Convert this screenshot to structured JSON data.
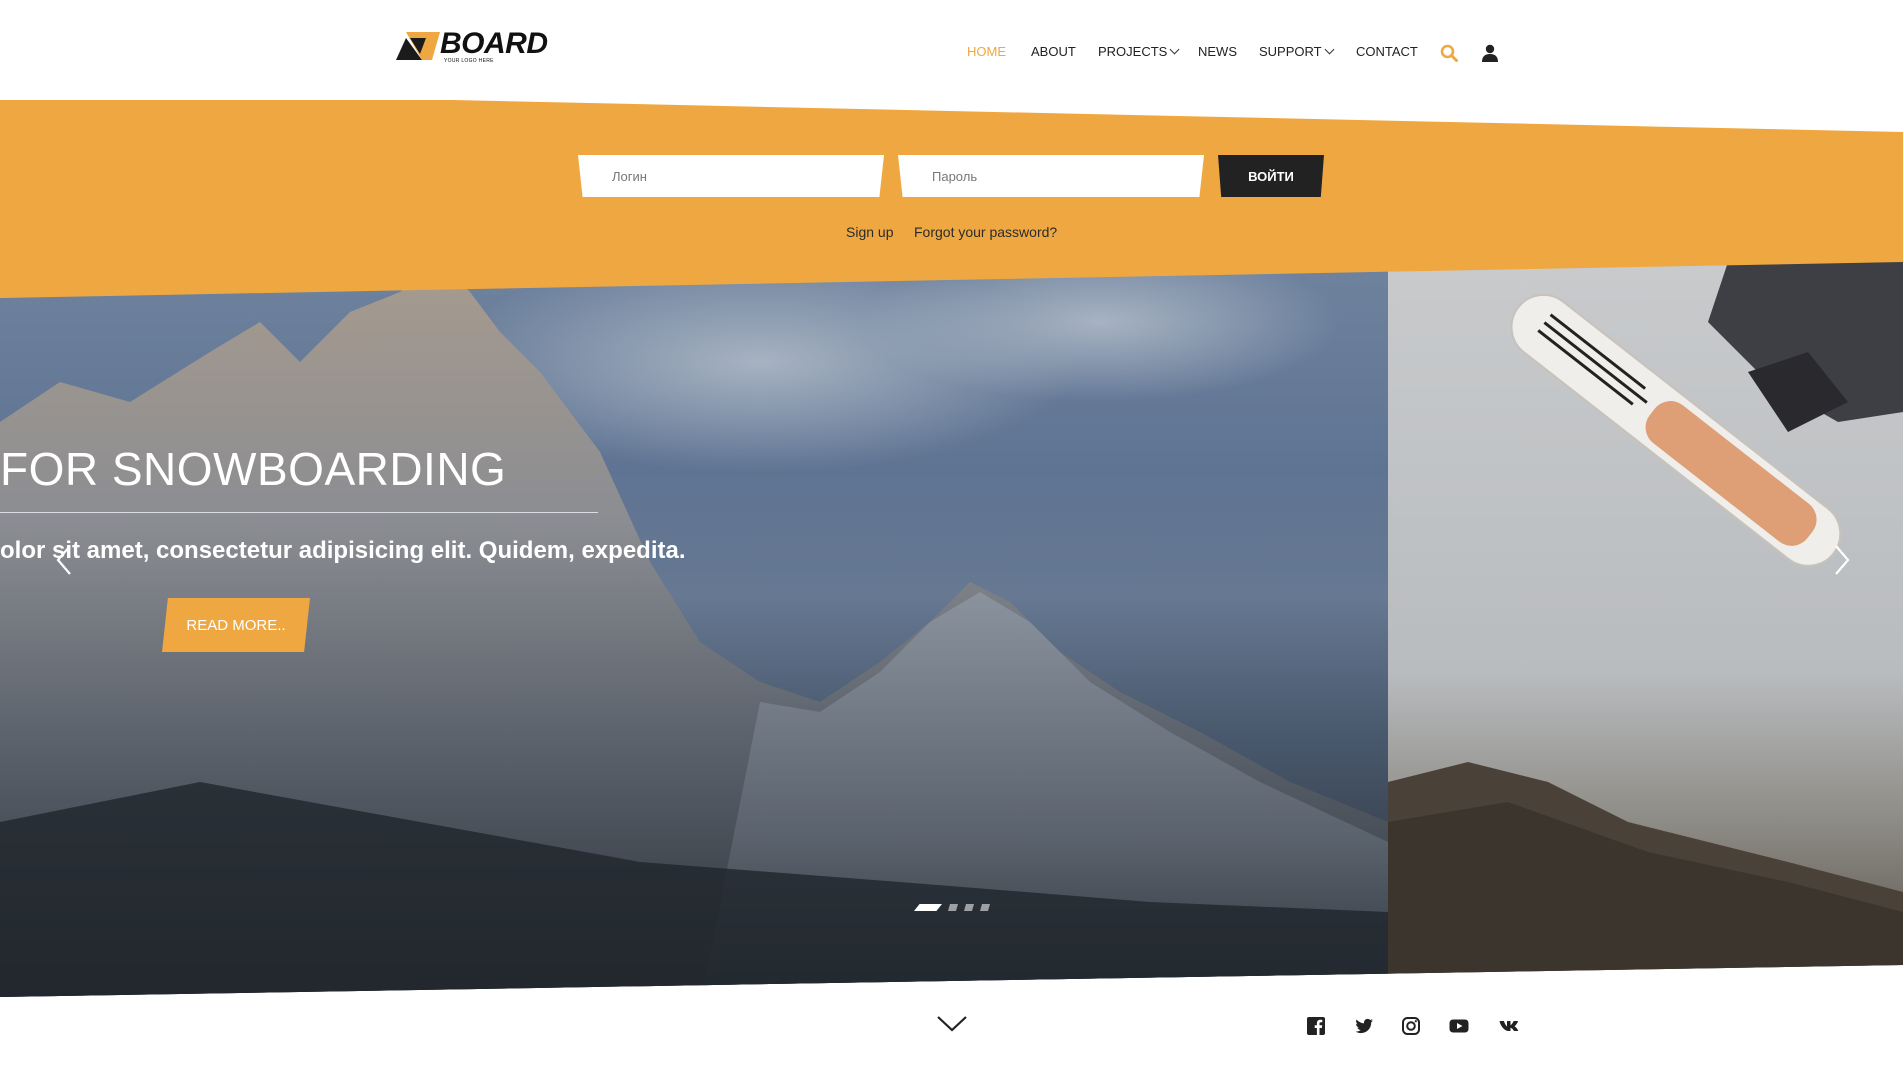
{
  "brand": {
    "name": "BOARD",
    "tagline": "YOUR LOGO HERE",
    "accent_color": "#efa841",
    "dark_color": "#222222"
  },
  "nav": {
    "items": [
      {
        "label": "HOME",
        "active": true
      },
      {
        "label": "ABOUT",
        "active": false
      },
      {
        "label": "PROJECTS",
        "active": false,
        "has_dropdown": true
      },
      {
        "label": "NEWS",
        "active": false
      },
      {
        "label": "SUPPORT",
        "active": false,
        "has_dropdown": true
      },
      {
        "label": "CONTACT",
        "active": false
      }
    ],
    "search_icon": "search-icon",
    "user_icon": "user-icon"
  },
  "login": {
    "login_placeholder": "Логин",
    "password_placeholder": "Пароль",
    "submit_label": "ВОЙТИ",
    "signup_label": "Sign up",
    "forgot_label": "Forgot your password?"
  },
  "hero": {
    "title": "FOR SNOWBOARDING",
    "description": "olor sit amet, consectetur adipisicing elit. Quidem, expedita.",
    "button_label": "READ MORE..",
    "prev_icon": "chevron-left-icon",
    "next_icon": "chevron-right-icon",
    "slides_count": 4,
    "active_slide": 1
  },
  "footer": {
    "scroll_icon": "chevron-down-icon",
    "social": [
      "facebook-icon",
      "twitter-icon",
      "instagram-icon",
      "youtube-icon",
      "vk-icon"
    ]
  }
}
